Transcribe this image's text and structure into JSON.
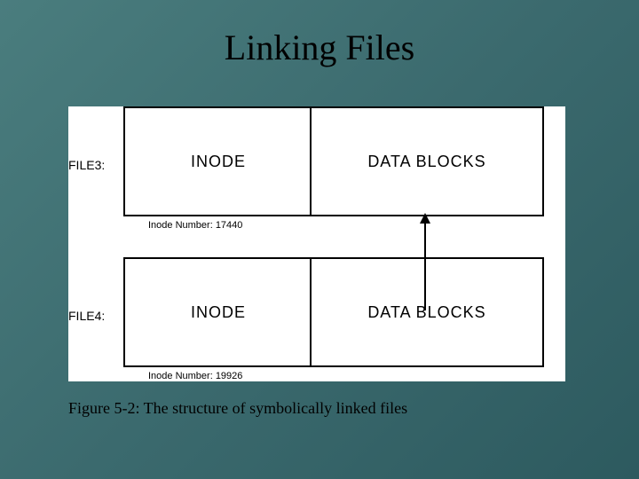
{
  "title": "Linking Files",
  "caption": "Figure 5-2: The structure of symbolically linked files",
  "labels": {
    "file3": "FILE3:",
    "file4": "FILE4:",
    "inode": "INODE",
    "datablocks": "DATA BLOCKS",
    "inode3_caption": "Inode Number: 17440",
    "inode4_caption": "Inode Number: 19926"
  }
}
